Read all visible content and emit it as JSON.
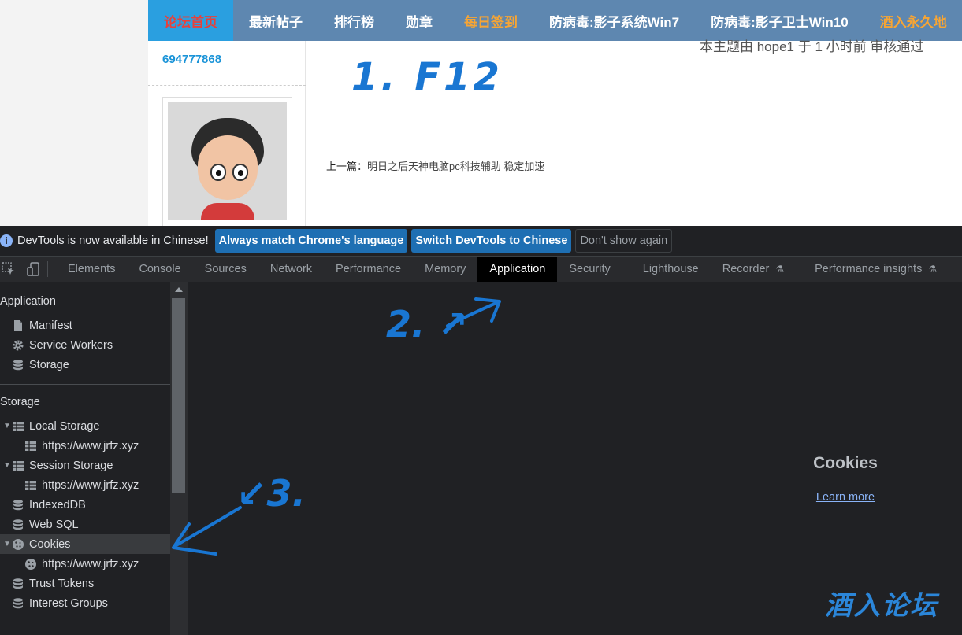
{
  "site": {
    "nav": [
      "论坛首页",
      "最新帖子",
      "排行榜",
      "勋章",
      "每日签到",
      "防病毒:影子系统Win7",
      "防病毒:影子卫士Win10",
      "酒入永久地"
    ],
    "user_id": "694777868",
    "reviewed_text": "本主题由 hope1 于 1 小时前 审核通过",
    "prev_label": "上一篇：",
    "prev_title": "明日之后天神电脑pc科技辅助 稳定加速"
  },
  "annotations": {
    "step1": "1. F12",
    "step2": "2. ↗",
    "step3": "↙3."
  },
  "infobar": {
    "message": "DevTools is now available in Chinese!",
    "btn_match": "Always match Chrome's language",
    "btn_switch": "Switch DevTools to Chinese",
    "btn_dismiss": "Don't show again"
  },
  "tabs": [
    "Elements",
    "Console",
    "Sources",
    "Network",
    "Performance",
    "Memory",
    "Application",
    "Security",
    "Lighthouse",
    "Recorder",
    "Performance insights"
  ],
  "active_tab": "Application",
  "sidebar": {
    "application_title": "Application",
    "application_items": [
      "Manifest",
      "Service Workers",
      "Storage"
    ],
    "storage_title": "Storage",
    "local_storage": "Local Storage",
    "local_origin": "https://www.jrfz.xyz",
    "session_storage": "Session Storage",
    "session_origin": "https://www.jrfz.xyz",
    "indexeddb": "IndexedDB",
    "websql": "Web SQL",
    "cookies": "Cookies",
    "cookies_origin": "https://www.jrfz.xyz",
    "trust_tokens": "Trust Tokens",
    "interest_groups": "Interest Groups"
  },
  "main": {
    "title": "Cookies",
    "learn_more": "Learn more"
  },
  "watermark": "酒入论坛",
  "colors": {
    "accent": "#1e6fb3",
    "annotation": "#1976d2"
  }
}
